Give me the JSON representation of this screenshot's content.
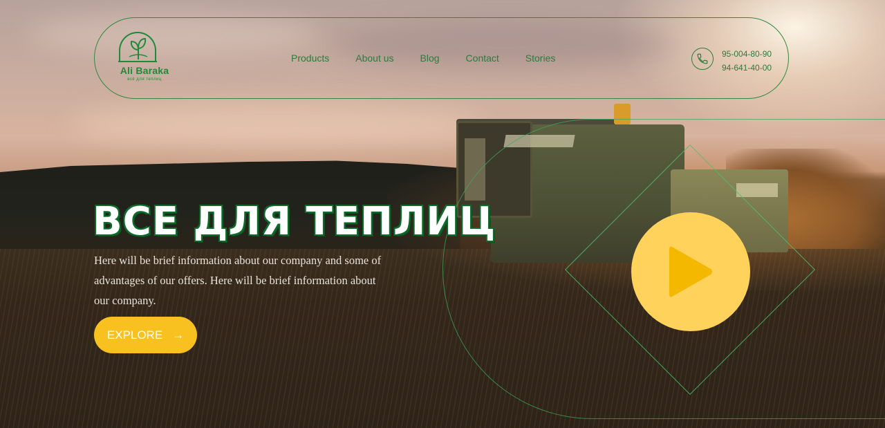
{
  "brand": {
    "name": "Ali Baraka",
    "tagline": "всё для теплиц",
    "color": "#1f8a3a"
  },
  "nav": {
    "items": [
      "Products",
      "About us",
      "Blog",
      "Contact",
      "Stories"
    ]
  },
  "contact": {
    "icon": "phone-icon",
    "phones": [
      "95-004-80-90",
      "94-641-40-00"
    ]
  },
  "hero": {
    "title": "ВСЕ ДЛЯ ТЕПЛИЦ",
    "description": "Here will be brief information about our company and some of advantages of our offers. Here will be brief information about our company.",
    "cta_label": "EXPLORE",
    "cta_arrow": "→",
    "cta_color": "#f9c11f",
    "play_color": "#ffd25c",
    "play_icon": "play-icon"
  },
  "colors": {
    "accent_green": "#2e7a3c",
    "line_green": "#2e8a3f"
  }
}
